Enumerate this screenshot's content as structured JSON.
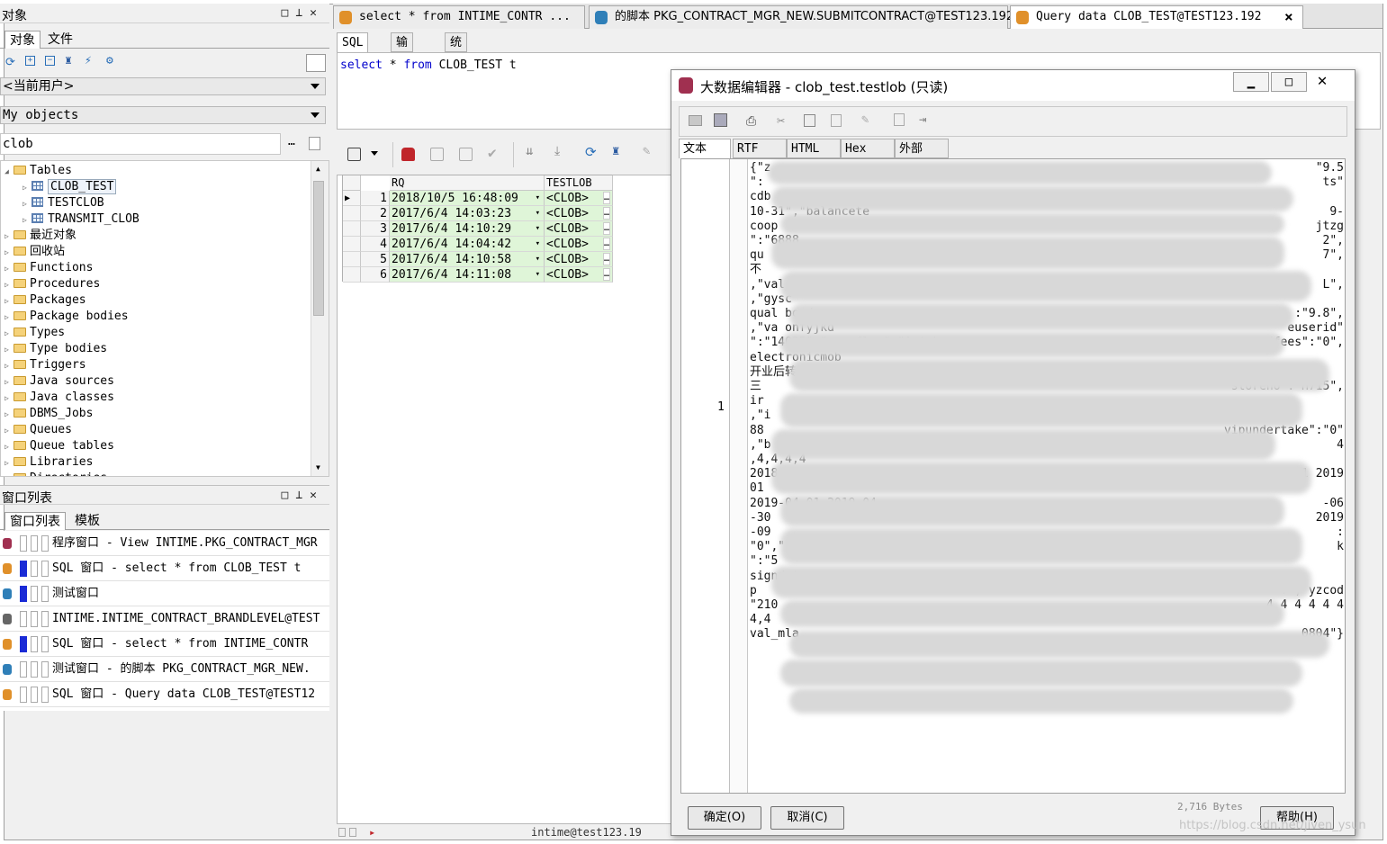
{
  "left_panel": {
    "objects_title": "对象",
    "tabs": [
      "对象",
      "文件"
    ],
    "user_combo": "<当前用户>",
    "objects_combo": "My objects",
    "filter_value": "clob",
    "tree": [
      {
        "label": "Tables",
        "type": "folder-open",
        "level": 0
      },
      {
        "label": "CLOB_TEST",
        "type": "table",
        "level": 1,
        "selected": true
      },
      {
        "label": "TESTCLOB",
        "type": "table",
        "level": 1
      },
      {
        "label": "TRANSMIT_CLOB",
        "type": "table",
        "level": 1
      },
      {
        "label": "最近对象",
        "type": "folder",
        "level": 0
      },
      {
        "label": "回收站",
        "type": "folder",
        "level": 0
      },
      {
        "label": "Functions",
        "type": "folder",
        "level": 0
      },
      {
        "label": "Procedures",
        "type": "folder",
        "level": 0
      },
      {
        "label": "Packages",
        "type": "folder",
        "level": 0
      },
      {
        "label": "Package bodies",
        "type": "folder-open",
        "level": 0
      },
      {
        "label": "Types",
        "type": "folder",
        "level": 0
      },
      {
        "label": "Type bodies",
        "type": "folder",
        "level": 0
      },
      {
        "label": "Triggers",
        "type": "folder",
        "level": 0
      },
      {
        "label": "Java sources",
        "type": "folder",
        "level": 0
      },
      {
        "label": "Java classes",
        "type": "folder",
        "level": 0
      },
      {
        "label": "DBMS_Jobs",
        "type": "folder",
        "level": 0
      },
      {
        "label": "Queues",
        "type": "folder",
        "level": 0
      },
      {
        "label": "Queue tables",
        "type": "folder",
        "level": 0
      },
      {
        "label": "Libraries",
        "type": "folder",
        "level": 0
      },
      {
        "label": "Directories",
        "type": "folder",
        "level": 0
      }
    ],
    "winlist_title": "窗口列表",
    "winlist_tabs": [
      "窗口列表",
      "模板"
    ],
    "windows": [
      {
        "text": "程序窗口 - View INTIME.PKG_CONTRACT_MGR",
        "color": "#a03050",
        "mark": false
      },
      {
        "text": "SQL 窗口 - select * from CLOB_TEST t",
        "color": "#e0902a",
        "mark": true
      },
      {
        "text": "测试窗口",
        "color": "#2f7fb8",
        "mark": true
      },
      {
        "text": "INTIME.INTIME_CONTRACT_BRANDLEVEL@TEST",
        "color": "#666666",
        "mark": false
      },
      {
        "text": "SQL 窗口 - select * from INTIME_CONTR",
        "color": "#e0902a",
        "mark": true
      },
      {
        "text": "测试窗口 - 的脚本 PKG_CONTRACT_MGR_NEW.",
        "color": "#2f7fb8",
        "mark": false
      },
      {
        "text": "SQL 窗口 - Query data CLOB_TEST@TEST12",
        "color": "#e0902a",
        "mark": false
      }
    ]
  },
  "editor_tabs": [
    {
      "label": "select * from INTIME_CONTR ...",
      "color": "#e0902a"
    },
    {
      "label": "的脚本 PKG_CONTRACT_MGR_NEW.SUBMITCONTRACT@TEST123.192",
      "color": "#2f7fb8"
    },
    {
      "label": "Query data CLOB_TEST@TEST123.192",
      "color": "#e0902a",
      "active": true
    }
  ],
  "close_glyph": "×",
  "sql_tabs": [
    "SQL",
    "输出",
    "统计表"
  ],
  "sql": {
    "kw1": "select",
    "star": "*",
    "kw2": "from",
    "rest": "CLOB_TEST t"
  },
  "grid": {
    "columns": [
      "RQ",
      "TESTLOB"
    ],
    "rows": [
      {
        "n": "1",
        "rq": "2018/10/5 16:48:09",
        "lob": "<CLOB>"
      },
      {
        "n": "2",
        "rq": "2017/6/4 14:03:23",
        "lob": "<CLOB>"
      },
      {
        "n": "3",
        "rq": "2017/6/4 14:10:29",
        "lob": "<CLOB>"
      },
      {
        "n": "4",
        "rq": "2017/6/4 14:04:42",
        "lob": "<CLOB>"
      },
      {
        "n": "5",
        "rq": "2017/6/4 14:10:58",
        "lob": "<CLOB>"
      },
      {
        "n": "6",
        "rq": "2017/6/4 14:11:08",
        "lob": "<CLOB>"
      }
    ]
  },
  "status": "intime@test123.19",
  "dialog": {
    "title": "大数据编辑器 - clob_test.testlob (只读)",
    "tabs": [
      "文本",
      "RTF",
      "HTML",
      "Hex",
      "外部"
    ],
    "line_no": "1",
    "visible_lines": [
      "{\"z",
      "\":",
      "cdb",
      "10-31\",\"balancete",
      "coop",
      "\":\"6888",
      "qu",
      "不",
      ",\"val_y",
      ",\"gysc",
      "qual bondr",
      ",\"va onfyjkd",
      "\":\"14035\",\"openflag\":\"Anish",
      "electronicmob",
      "开业后转为质量保证金",
      "三",
      "ir",
      ",\"i",
      "88",
      ",\"b",
      ",4,4,4,4",
      "2018 2018-11-30 2.5",
      "01",
      "2019-04-01 2019-04-",
      "-30",
      "-09",
      "\"0\",\"r",
      "\":\"5",
      "signdate",
      "p",
      "\"210",
      "4,4",
      "val_mla"
    ],
    "right_bits": [
      {
        "line": 0,
        "text": "\"9.5"
      },
      {
        "line": 1,
        "text": "ts\""
      },
      {
        "line": 3,
        "text": "9-"
      },
      {
        "line": 4,
        "text": "jtzg"
      },
      {
        "line": 5,
        "text": "2\","
      },
      {
        "line": 6,
        "text": "7\","
      },
      {
        "line": 8,
        "text": "L\","
      },
      {
        "line": 10,
        "text": ":\"9.8\","
      },
      {
        "line": 11,
        "text": "euserid\""
      },
      {
        "line": 12,
        "text": "cardfees\":\"0\","
      },
      {
        "line": 15,
        "text": "storeno\":\"H715\","
      },
      {
        "line": 18,
        "text": "vipundertake\":\"0\""
      },
      {
        "line": 19,
        "text": "4"
      },
      {
        "line": 21,
        "text": "2018-12-31 2.5 2 | 2019-01-01 2019"
      },
      {
        "line": 23,
        "text": "-06"
      },
      {
        "line": 24,
        "text": "2019"
      },
      {
        "line": 25,
        "text": ":"
      },
      {
        "line": 26,
        "text": "k"
      },
      {
        "line": 29,
        "text": "\"Y\", yzcod"
      },
      {
        "line": 30,
        "text": "4 4 4 4 4 4"
      },
      {
        "line": 32,
        "text": "0804\"}"
      }
    ],
    "bytes": "2,716 Bytes",
    "ok": "确定(O)",
    "cancel": "取消(C)",
    "help": "帮助(H)"
  },
  "watermark": "https://blog.csdn.net/jiven_ysun",
  "colors": {
    "accent_blue": "#0000cc",
    "grid_green": "#dff5d8",
    "sql_orange": "#e0902a",
    "test_blue": "#2f7fb8",
    "program_red": "#a03050"
  }
}
